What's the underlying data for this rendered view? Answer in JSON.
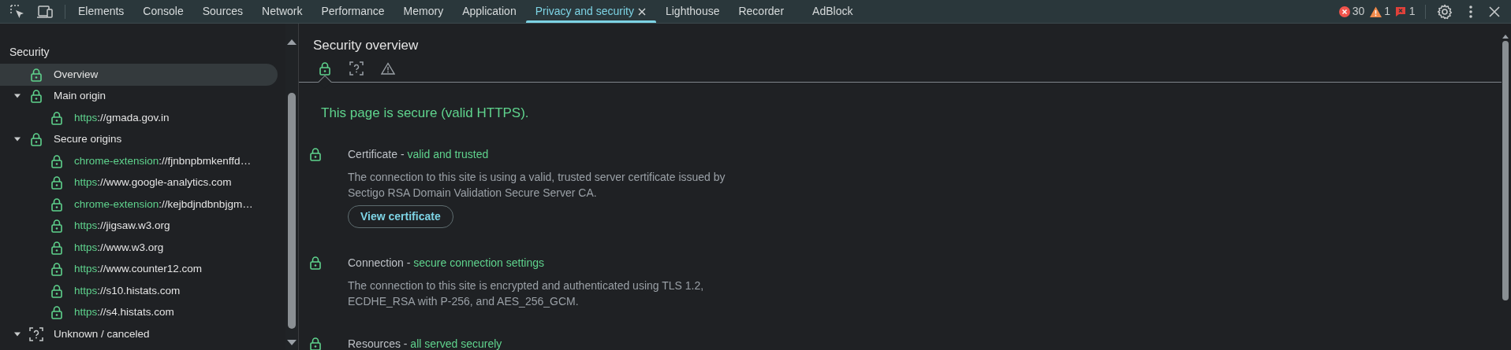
{
  "toolbar": {
    "tabs": [
      {
        "label": "Elements",
        "selected": false,
        "closable": false
      },
      {
        "label": "Console",
        "selected": false,
        "closable": false
      },
      {
        "label": "Sources",
        "selected": false,
        "closable": false
      },
      {
        "label": "Network",
        "selected": false,
        "closable": false
      },
      {
        "label": "Performance",
        "selected": false,
        "closable": false
      },
      {
        "label": "Memory",
        "selected": false,
        "closable": false
      },
      {
        "label": "Application",
        "selected": false,
        "closable": false
      },
      {
        "label": "Privacy and security",
        "selected": true,
        "closable": true
      },
      {
        "label": "Lighthouse",
        "selected": false,
        "closable": false
      },
      {
        "label": "Recorder",
        "selected": false,
        "closable": false
      },
      {
        "label": "AdBlock",
        "selected": false,
        "closable": false
      }
    ],
    "counters": [
      {
        "kind": "error",
        "count": "30"
      },
      {
        "kind": "warning",
        "count": "1"
      },
      {
        "kind": "issue",
        "count": "1"
      }
    ]
  },
  "sidebar": {
    "section_title": "Security",
    "items": [
      {
        "label": "Overview",
        "kind": "secure",
        "selected": true
      },
      {
        "label": "Main origin",
        "kind": "secure",
        "selected": false,
        "expanded": true,
        "children": [
          {
            "kind": "secure",
            "scheme": "https",
            "host": "://gmada.gov.in",
            "selected": false
          }
        ]
      },
      {
        "label": "Secure origins",
        "kind": "secure",
        "selected": false,
        "expanded": true,
        "children": [
          {
            "kind": "secure",
            "scheme": "chrome-extension",
            "host": "://fjnbnpbmkenffd…",
            "selected": false
          },
          {
            "kind": "secure",
            "scheme": "https",
            "host": "://www.google-analytics.com",
            "selected": false
          },
          {
            "kind": "secure",
            "scheme": "chrome-extension",
            "host": "://kejbdjndbnbjgm…",
            "selected": false
          },
          {
            "kind": "secure",
            "scheme": "https",
            "host": "://jigsaw.w3.org",
            "selected": false
          },
          {
            "kind": "secure",
            "scheme": "https",
            "host": "://www.w3.org",
            "selected": false
          },
          {
            "kind": "secure",
            "scheme": "https",
            "host": "://www.counter12.com",
            "selected": false
          },
          {
            "kind": "secure",
            "scheme": "https",
            "host": "://s10.histats.com",
            "selected": false
          },
          {
            "kind": "secure",
            "scheme": "https",
            "host": "://s4.histats.com",
            "selected": false
          }
        ]
      },
      {
        "label": "Unknown / canceled",
        "kind": "unknown",
        "selected": false,
        "expanded": true
      }
    ]
  },
  "main": {
    "title": "Security overview",
    "view_tabs": [
      {
        "kind": "secure",
        "selected": true
      },
      {
        "kind": "unknown",
        "selected": false
      },
      {
        "kind": "insecure",
        "selected": false
      }
    ],
    "summary": "This page is secure (valid HTTPS).",
    "sections": [
      {
        "kind": "secure",
        "title": "Certificate -",
        "status": "valid and trusted",
        "description": "The connection to this site is using a valid, trusted server certificate issued by Sectigo RSA Domain Validation Secure Server CA.",
        "button": "View certificate"
      },
      {
        "kind": "secure",
        "title": "Connection -",
        "status": "secure connection settings",
        "description": "The connection to this site is encrypted and authenticated using TLS 1.2, ECDHE_RSA with P-256, and AES_256_GCM."
      },
      {
        "kind": "secure",
        "title": "Resources -",
        "status": "all served securely"
      }
    ]
  }
}
